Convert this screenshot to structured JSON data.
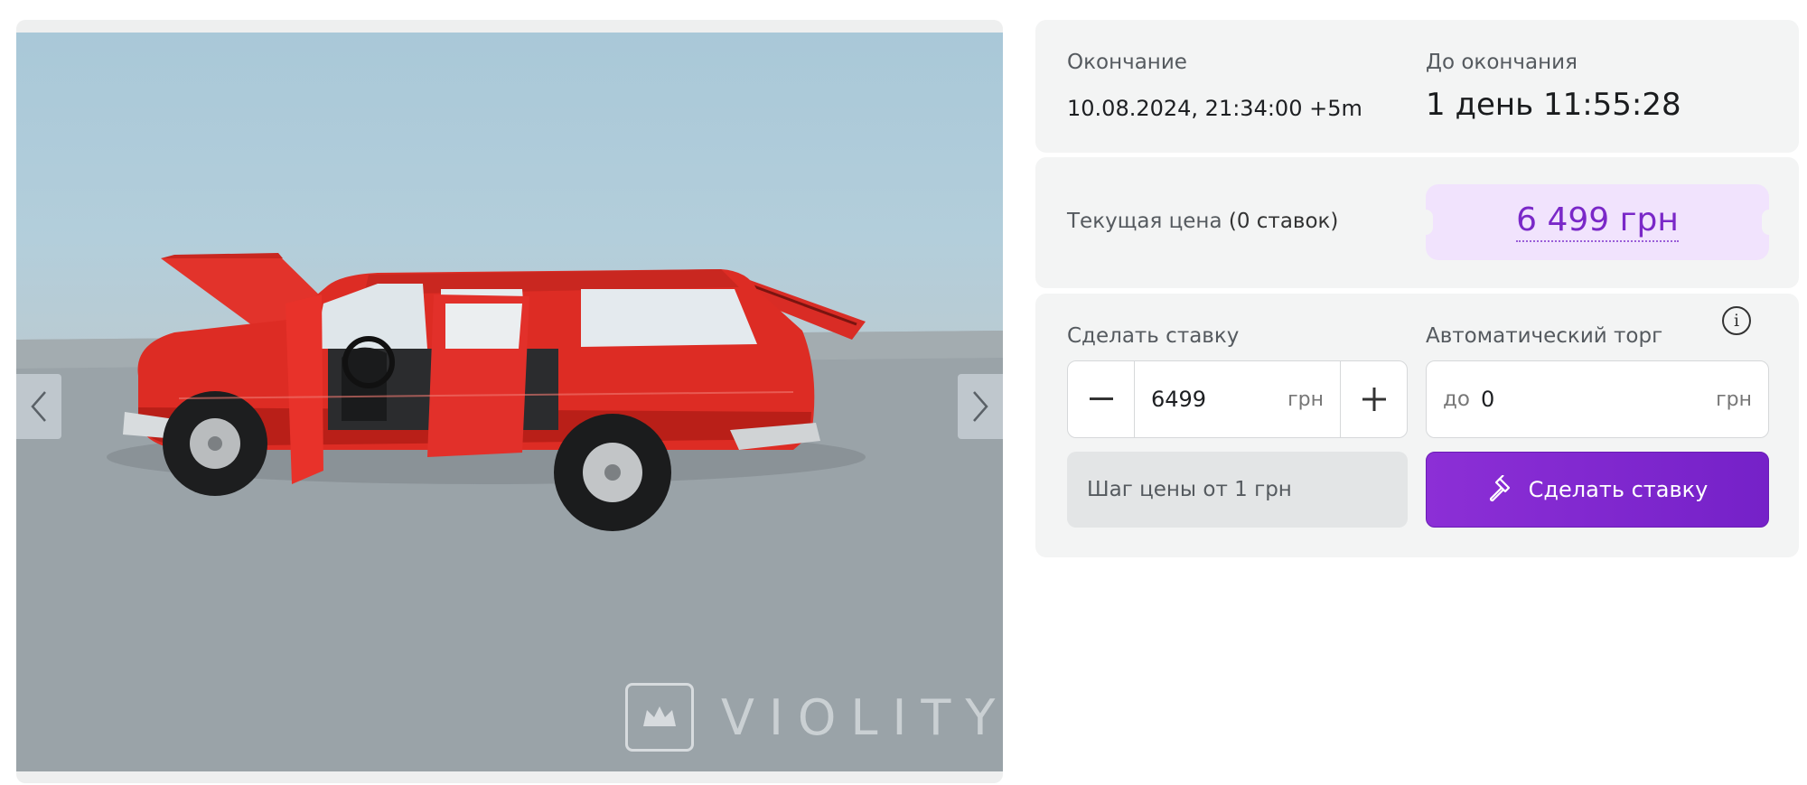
{
  "gallery": {
    "watermark_text": "VIOLITY",
    "prev_icon": "chevron-left-icon",
    "next_icon": "chevron-right-icon"
  },
  "auction_end": {
    "end_label": "Окончание",
    "end_value": "10.08.2024, 21:34:00 +5m",
    "remaining_label": "До окончания",
    "remaining_value": "1 день 11:55:28"
  },
  "price": {
    "label": "Текущая цена",
    "bids_count": "(0 ставок)",
    "value": "6 499 грн"
  },
  "bid": {
    "label": "Сделать ставку",
    "amount": "6499",
    "currency": "грн",
    "step_note": "Шаг цены от 1 грн",
    "submit_label": "Сделать ставку",
    "submit_icon": "hammer-icon"
  },
  "auto_bid": {
    "label": "Автоматический торг",
    "prefix": "до",
    "value": "0",
    "currency": "грн",
    "info_icon": "info-icon",
    "info_glyph": "i"
  },
  "colors": {
    "accent": "#7a28c8",
    "price_bg": "#f1e3fd",
    "panel_bg": "#f3f4f4",
    "button_bg": "#8029cf"
  }
}
